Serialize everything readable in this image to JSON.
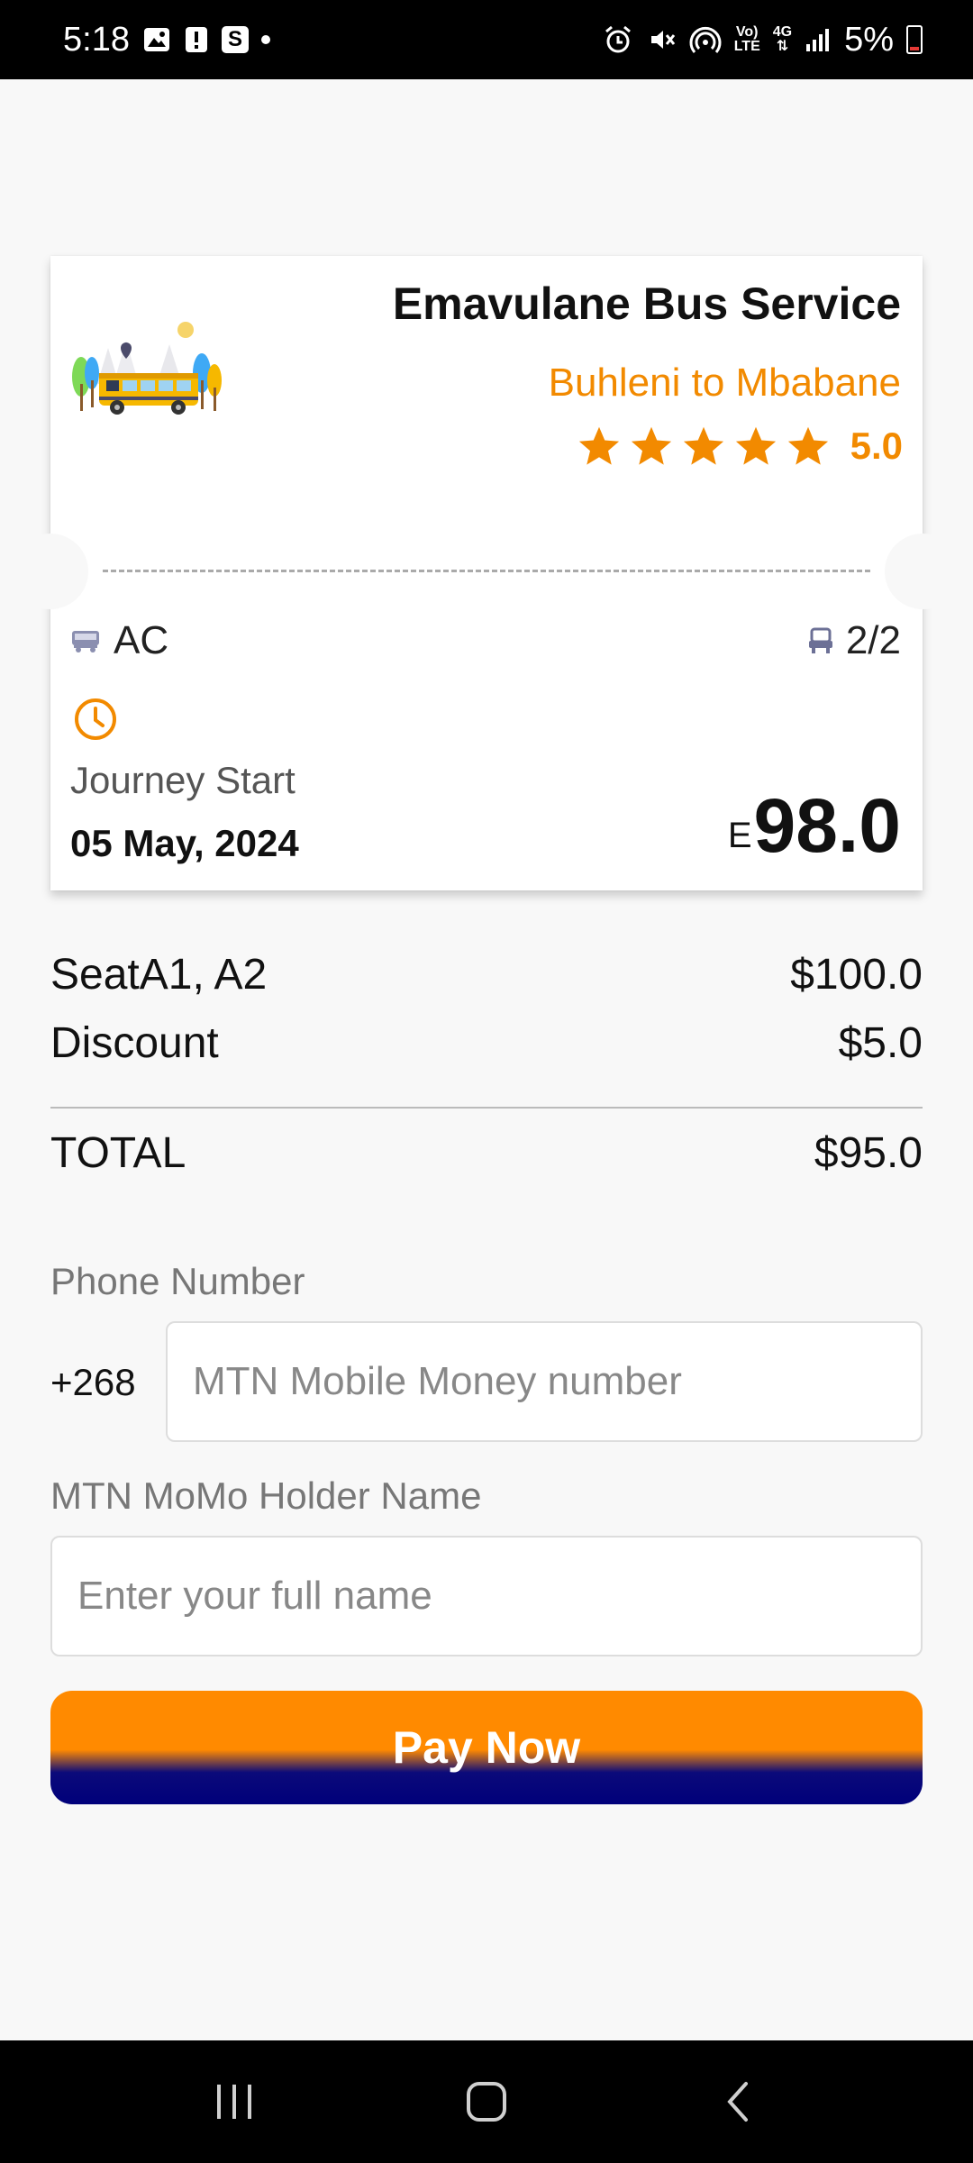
{
  "status_bar": {
    "time": "5:18",
    "notification_s": "S",
    "battery": "5%"
  },
  "ticket": {
    "operator": "Emavulane Bus Service",
    "route": "Buhleni to Mbabane",
    "rating": "5.0",
    "stars": 5,
    "ac_label": "AC",
    "seats": "2/2",
    "journey_label": "Journey Start",
    "journey_date": "05 May, 2024",
    "price_currency": "E",
    "price": "98.0"
  },
  "summary": {
    "seat_label": "SeatA1, A2",
    "seat_amount": "$100.0",
    "discount_label": "Discount",
    "discount_amount": "$5.0",
    "total_label": "TOTAL",
    "total_amount": "$95.0"
  },
  "form": {
    "phone_label": "Phone Number",
    "country_code": "+268",
    "phone_placeholder": "MTN Mobile Money number",
    "phone_value": "",
    "name_label": "MTN MoMo Holder Name",
    "name_placeholder": "Enter your full name",
    "name_value": ""
  },
  "pay_button_label": "Pay Now",
  "colors": {
    "accent": "#f28a00",
    "button_top": "#ff8a00",
    "button_bottom": "#00007a"
  }
}
